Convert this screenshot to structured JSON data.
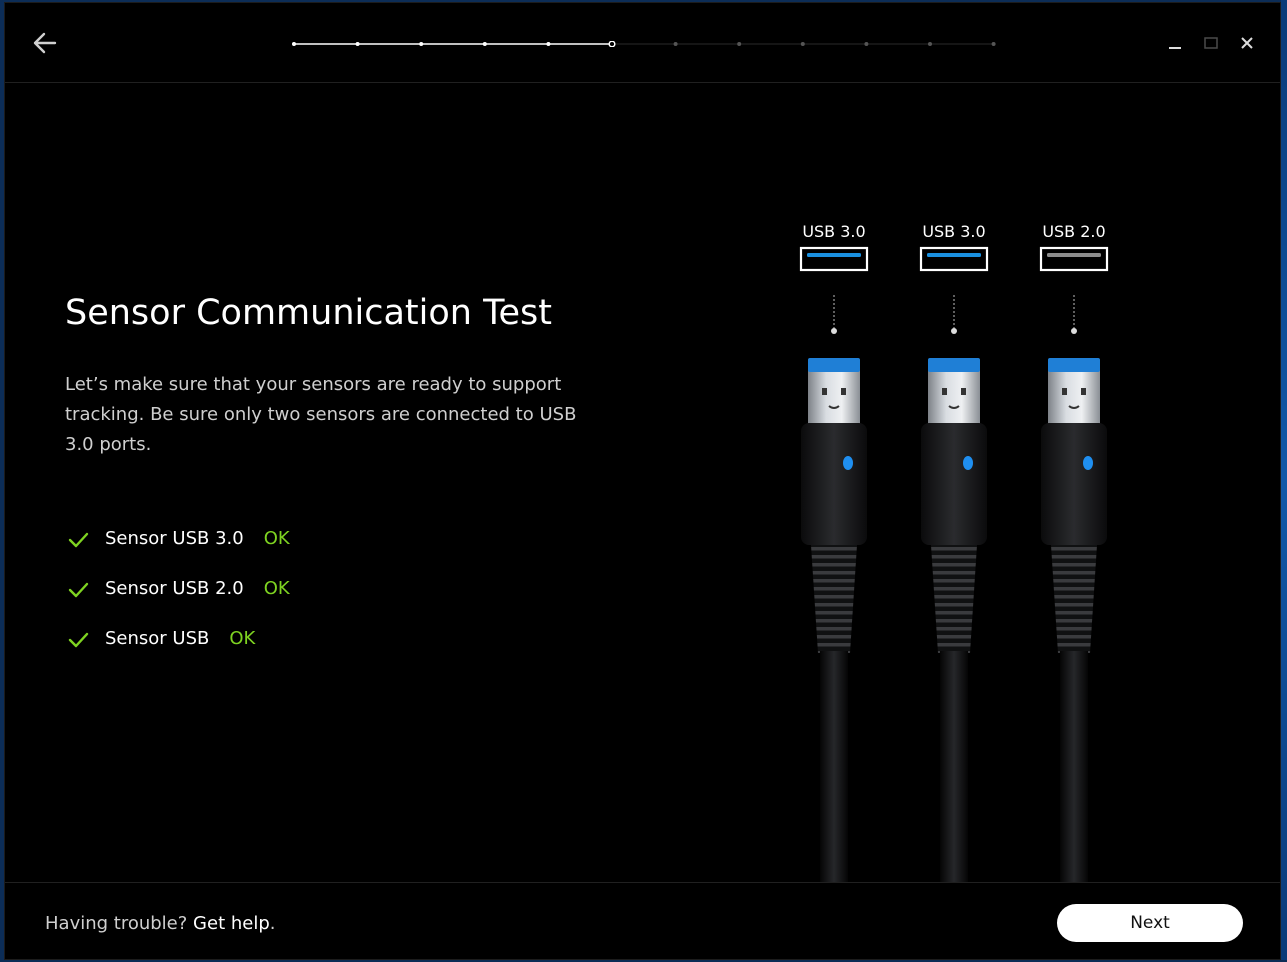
{
  "window": {
    "back_icon": "arrow-left-icon",
    "controls": [
      "minimize-icon",
      "maximize-icon",
      "close-icon"
    ]
  },
  "progress": {
    "total_steps": 12,
    "current_step": 6
  },
  "main": {
    "title": "Sensor Communication Test",
    "description": "Let’s make sure that your sensors are ready to support tracking. Be sure only two sensors are connected to USB 3.0 ports.",
    "checks": [
      {
        "label": "Sensor USB 3.0",
        "status": "OK"
      },
      {
        "label": "Sensor USB 2.0",
        "status": "OK"
      },
      {
        "label": "Sensor USB",
        "status": "OK"
      }
    ]
  },
  "illustration": {
    "ports": [
      {
        "label": "USB 3.0",
        "color": "#1a90e0"
      },
      {
        "label": "USB 3.0",
        "color": "#1a90e0"
      },
      {
        "label": "USB 2.0",
        "color": "#8c8c8c"
      }
    ]
  },
  "footer": {
    "help_text": "Having trouble? ",
    "help_link": "Get help",
    "help_suffix": ".",
    "next_label": "Next"
  },
  "colors": {
    "accent_ok": "#7ed321",
    "usb3": "#1a90e0",
    "background": "#000000"
  }
}
